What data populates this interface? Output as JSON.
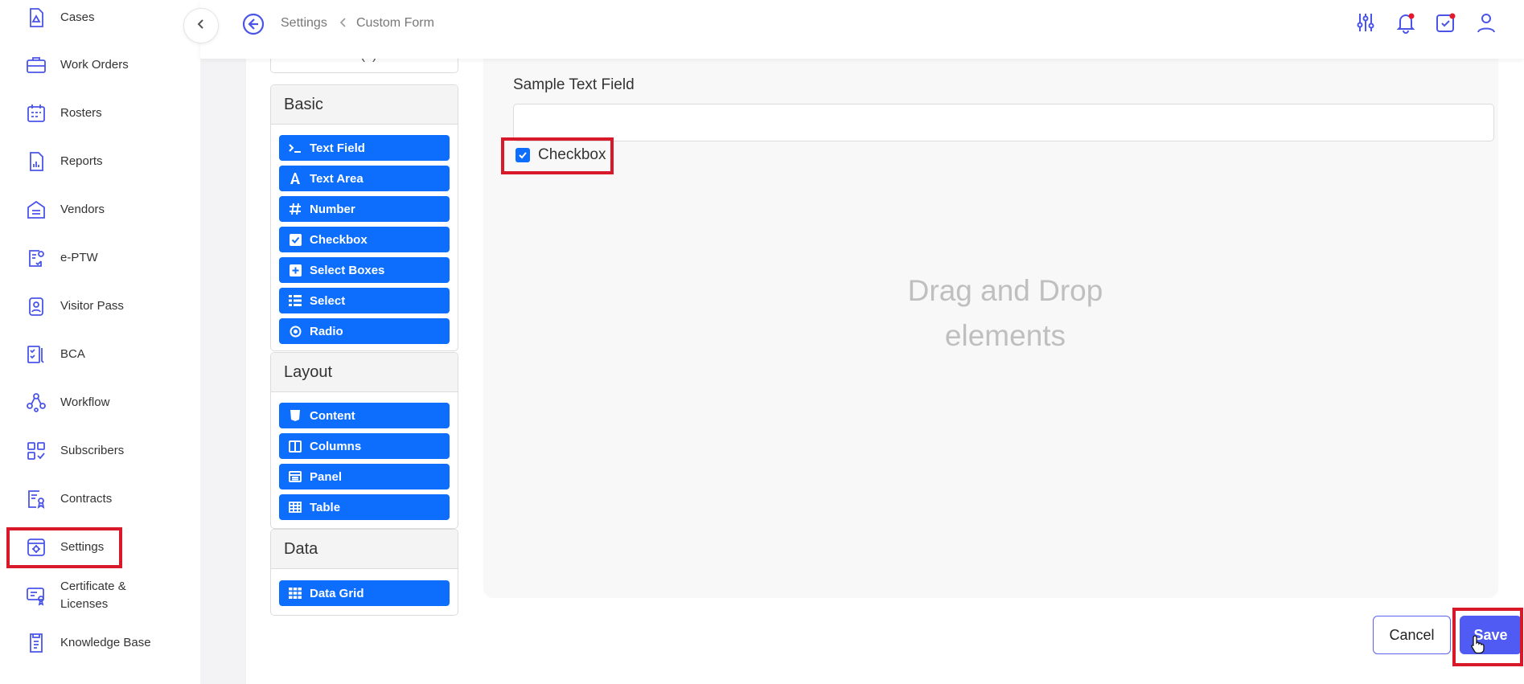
{
  "sidebar": {
    "items": [
      {
        "label": "Cases",
        "icon": "cases-icon"
      },
      {
        "label": "Work Orders",
        "icon": "work-orders-icon"
      },
      {
        "label": "Rosters",
        "icon": "rosters-icon"
      },
      {
        "label": "Reports",
        "icon": "reports-icon"
      },
      {
        "label": "Vendors",
        "icon": "vendors-icon"
      },
      {
        "label": "e-PTW",
        "icon": "eptw-icon"
      },
      {
        "label": "Visitor Pass",
        "icon": "visitor-pass-icon"
      },
      {
        "label": "BCA",
        "icon": "bca-icon"
      },
      {
        "label": "Workflow",
        "icon": "workflow-icon"
      },
      {
        "label": "Subscribers",
        "icon": "subscribers-icon"
      },
      {
        "label": "Contracts",
        "icon": "contracts-icon"
      },
      {
        "label": "Settings",
        "icon": "settings-icon"
      },
      {
        "label": "Certificate & Licenses",
        "icon": "certificate-icon"
      },
      {
        "label": "Knowledge Base",
        "icon": "knowledge-base-icon"
      }
    ],
    "collapse_icon": "chevron-left-icon"
  },
  "header": {
    "breadcrumb": [
      "Settings",
      "Custom Form"
    ],
    "icons": [
      "sliders-icon",
      "notification-bell-icon",
      "tasks-icon",
      "user-icon"
    ]
  },
  "palette": {
    "search_partial": "Search field(s)",
    "groups": [
      {
        "title": "Basic",
        "items": [
          {
            "label": "Text Field",
            "icon": "terminal-icon"
          },
          {
            "label": "Text Area",
            "icon": "font-icon"
          },
          {
            "label": "Number",
            "icon": "hash-icon"
          },
          {
            "label": "Checkbox",
            "icon": "check-square-icon"
          },
          {
            "label": "Select Boxes",
            "icon": "plus-square-icon"
          },
          {
            "label": "Select",
            "icon": "list-icon"
          },
          {
            "label": "Radio",
            "icon": "dot-circle-icon"
          }
        ]
      },
      {
        "title": "Layout",
        "items": [
          {
            "label": "Content",
            "icon": "html5-icon"
          },
          {
            "label": "Columns",
            "icon": "columns-icon"
          },
          {
            "label": "Panel",
            "icon": "panel-icon"
          },
          {
            "label": "Table",
            "icon": "table-icon"
          }
        ]
      },
      {
        "title": "Data",
        "items": [
          {
            "label": "Data Grid",
            "icon": "grid-icon"
          }
        ]
      }
    ]
  },
  "form": {
    "text_field_label": "Sample Text Field",
    "text_field_value": "",
    "checkbox_label": "Checkbox",
    "checkbox_checked": true,
    "drop_hint_line1": "Drag and Drop",
    "drop_hint_line2": "elements"
  },
  "actions": {
    "cancel_label": "Cancel",
    "save_label": "Save"
  },
  "colors": {
    "accent": "#0d6efd",
    "nav_icon": "#4a55e8",
    "save_button": "#4f5bf2",
    "highlight": "#d7192a"
  }
}
